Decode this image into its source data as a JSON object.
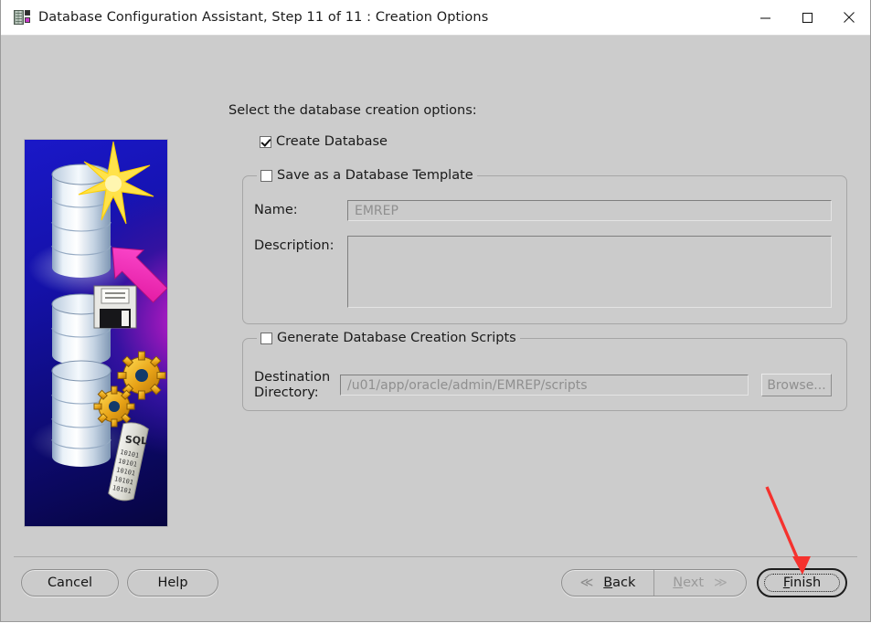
{
  "window": {
    "title": "Database Configuration Assistant, Step 11 of 11 : Creation Options",
    "icon": "database-rack-icon",
    "controls": {
      "minimize": "minimize-button",
      "maximize": "maximize-button",
      "close": "close-button"
    }
  },
  "sidebar": {
    "art_alt": "Oracle database creation illustration: stacked database cylinders with star burst, magenta arrow, floppy disk, gears and SQL script scroll"
  },
  "form": {
    "intro_label": "Select the database creation options:",
    "create_database": {
      "label": "Create Database",
      "checked": true
    },
    "template_group": {
      "legend": "Save as a Database Template",
      "checked": false,
      "name_label": "Name:",
      "name_value": "EMREP",
      "description_label": "Description:",
      "description_value": ""
    },
    "scripts_group": {
      "legend": "Generate Database Creation Scripts",
      "checked": false,
      "destination_label_line1": "Destination",
      "destination_label_line2": "Directory:",
      "destination_value": "/u01/app/oracle/admin/EMREP/scripts",
      "browse_label": "Browse...",
      "browse_enabled": false
    }
  },
  "footer": {
    "cancel_label": "Cancel",
    "help_label": "Help",
    "back": {
      "label_pre": "",
      "mnemonic": "B",
      "label_post": "ack",
      "chevron": "≪"
    },
    "next": {
      "mnemonic": "N",
      "label_post": "ext",
      "chevron": "≫",
      "enabled": false
    },
    "finish": {
      "mnemonic": "F",
      "label_post": "inish",
      "focused": true
    }
  },
  "annotation": {
    "type": "arrow",
    "color": "#f5322e",
    "points_to": "finish-button"
  }
}
